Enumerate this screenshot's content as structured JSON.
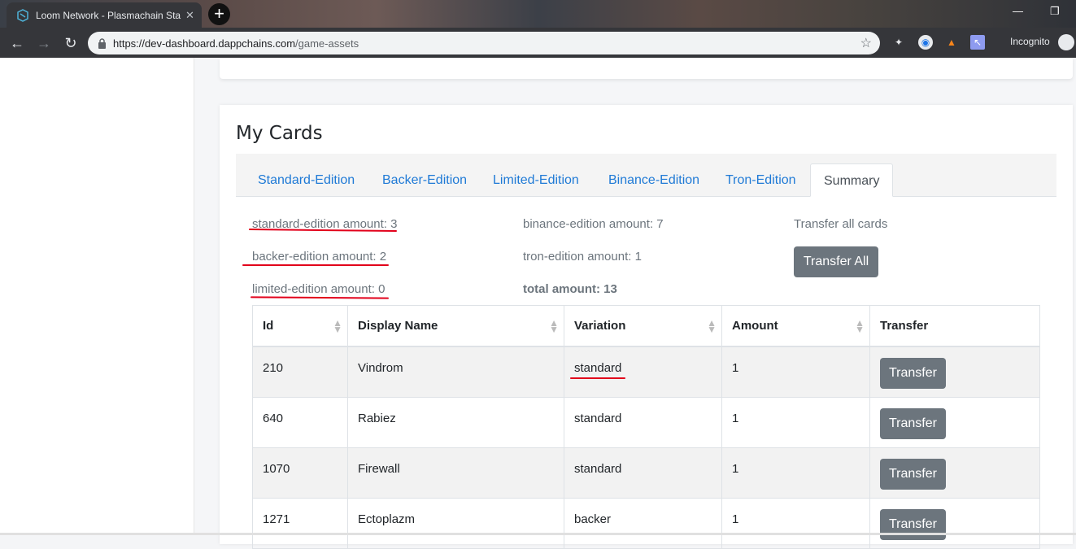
{
  "browser": {
    "tab_title": "Loom Network - Plasmachain Sta",
    "url_base": "https://dev-dashboard.dappchains.com",
    "url_path": "/game-assets",
    "incognito_label": "Incognito"
  },
  "page": {
    "heading": "My Cards",
    "tabs": [
      "Standard-Edition",
      "Backer-Edition",
      "Limited-Edition",
      "Binance-Edition",
      "Tron-Edition",
      "Summary"
    ],
    "active_tab": "Summary",
    "summary": {
      "standard": "standard-edition amount: 3",
      "backer": "backer-edition amount: 2",
      "limited": "limited-edition amount: 0",
      "binance": "binance-edition amount: 7",
      "tron": "tron-edition amount: 1",
      "total": "total amount: 13",
      "transfer_all_label": "Transfer all cards",
      "transfer_all_button": "Transfer All"
    },
    "table": {
      "headers": [
        "Id",
        "Display Name",
        "Variation",
        "Amount",
        "Transfer"
      ],
      "rows": [
        {
          "id": "210",
          "name": "Vindrom",
          "variation": "standard",
          "amount": "1",
          "action": "Transfer"
        },
        {
          "id": "640",
          "name": "Rabiez",
          "variation": "standard",
          "amount": "1",
          "action": "Transfer"
        },
        {
          "id": "1070",
          "name": "Firewall",
          "variation": "standard",
          "amount": "1",
          "action": "Transfer"
        },
        {
          "id": "1271",
          "name": "Ectoplazm",
          "variation": "backer",
          "amount": "1",
          "action": "Transfer"
        }
      ]
    }
  },
  "colors": {
    "link": "#1f7ad6",
    "button": "#6c757d",
    "annotation": "#e2001a"
  }
}
